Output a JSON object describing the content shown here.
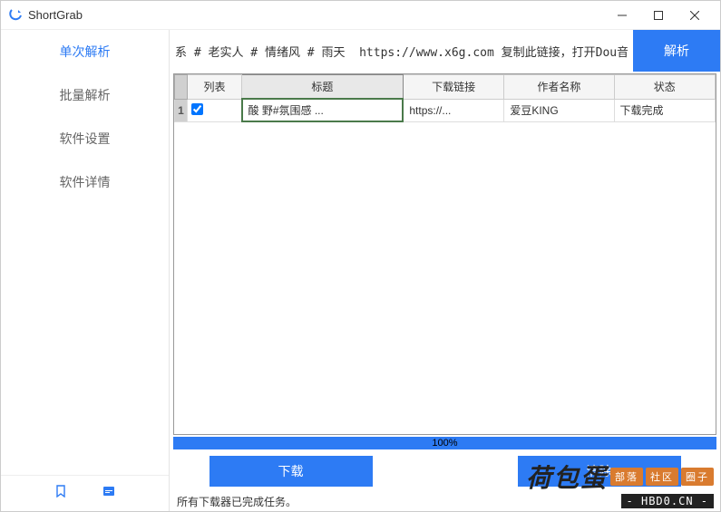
{
  "window": {
    "title": "ShortGrab"
  },
  "sidebar": {
    "items": [
      {
        "label": "单次解析",
        "active": true
      },
      {
        "label": "批量解析",
        "active": false
      },
      {
        "label": "软件设置",
        "active": false
      },
      {
        "label": "软件详情",
        "active": false
      }
    ]
  },
  "urlbar": {
    "value": "系 # 老实人 # 情绪风 # 雨天  https://www.x6g.com 复制此链接，打开Dou音搜索，直接观",
    "parse_label": "解析"
  },
  "table": {
    "headers": [
      "列表",
      "标题",
      "下载链接",
      "作者名称",
      "状态"
    ],
    "rows": [
      {
        "num": "1",
        "checked": true,
        "title": "酸  野#氛围感 ...",
        "link": "https://...",
        "author": "爱豆KING",
        "status": "下载完成"
      }
    ]
  },
  "progress": {
    "text": "100%"
  },
  "buttons": {
    "download": "下载",
    "clear": "清除"
  },
  "status": {
    "text": "所有下载器已完成任务。"
  },
  "watermark": {
    "main": "荷包蛋",
    "badges": [
      "部落",
      "社区",
      "圈子"
    ],
    "sub": "- HBD0.CN -"
  }
}
